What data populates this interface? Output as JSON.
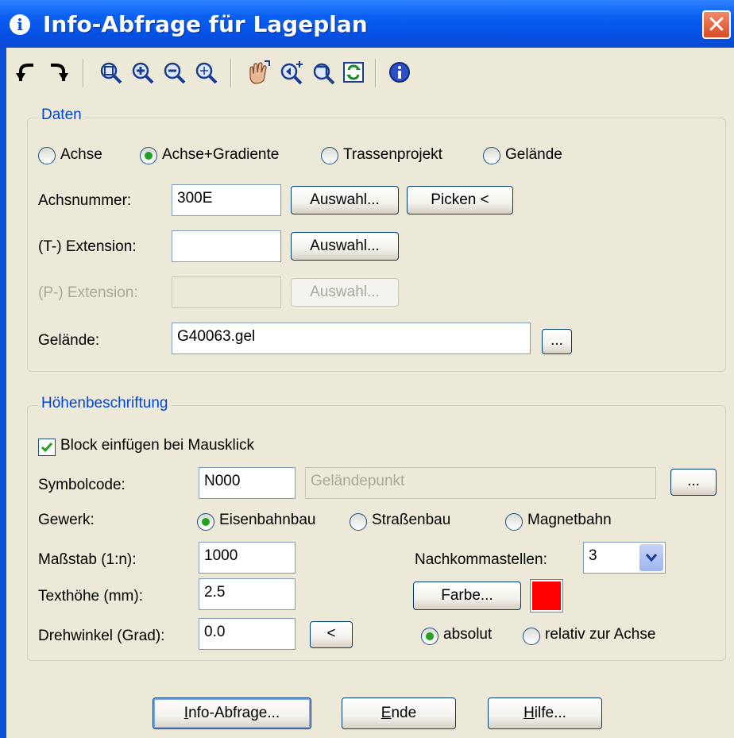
{
  "window": {
    "title": "Info-Abfrage für Lageplan",
    "close": "✕"
  },
  "toolbar": {
    "icons": [
      "undo-icon",
      "redo-icon",
      "zoom-window-icon",
      "zoom-in-icon",
      "zoom-out-icon",
      "zoom-all-icon",
      "pan-icon",
      "zoom-pick-icon",
      "zoom-previous-icon",
      "regenerate-icon",
      "info-icon"
    ]
  },
  "daten": {
    "legend": "Daten",
    "radios": [
      {
        "label": "Achse",
        "selected": false
      },
      {
        "label": "Achse+Gradiente",
        "selected": true
      },
      {
        "label": "Trassenprojekt",
        "selected": false
      },
      {
        "label": "Gelände",
        "selected": false
      }
    ],
    "achsnummer_label": "Achsnummer:",
    "achsnummer_value": "300E",
    "auswahl": "Auswahl...",
    "picken": "Picken <",
    "t_ext_label": "(T-) Extension:",
    "t_ext_value": "",
    "p_ext_label": "(P-) Extension:",
    "p_ext_value": "",
    "gelaende_label": "Gelände:",
    "gelaende_value": "G40063.gel",
    "browse": "..."
  },
  "hoehen": {
    "legend": "Höhenbeschriftung",
    "block_label": "Block einfügen bei Mausklick",
    "block_checked": true,
    "symbolcode_label": "Symbolcode:",
    "symbolcode_value": "N000",
    "symbol_desc": "Geländepunkt",
    "browse": "...",
    "gewerk_label": "Gewerk:",
    "gewerk": [
      {
        "label": "Eisenbahnbau",
        "selected": true
      },
      {
        "label": "Straßenbau",
        "selected": false
      },
      {
        "label": "Magnetbahn",
        "selected": false
      }
    ],
    "massstab_label": "Maßstab (1:n):",
    "massstab_value": "1000",
    "nachkomma_label": "Nachkommastellen:",
    "nachkomma_value": "3",
    "texthoehe_label": "Texthöhe (mm):",
    "texthoehe_value": "2.5",
    "farbe": "Farbe...",
    "color": "#ff0000",
    "drehwinkel_label": "Drehwinkel (Grad):",
    "drehwinkel_value": "0.0",
    "pick": "<",
    "absolut": "absolut",
    "relativ": "relativ zur Achse"
  },
  "footer": {
    "info_pre": "",
    "info_ul": "I",
    "info_post": "nfo-Abfrage...",
    "ende_ul": "E",
    "ende_post": "nde",
    "hilfe_ul": "H",
    "hilfe_post": "ilfe..."
  }
}
